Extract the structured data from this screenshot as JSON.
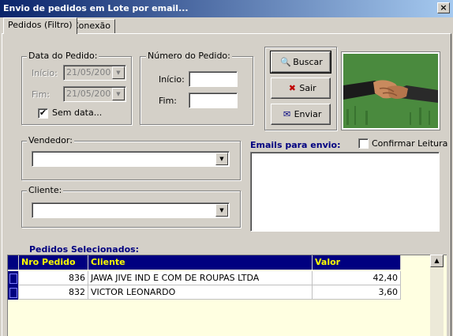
{
  "window": {
    "title": "Envio de pedidos em Lote por email...",
    "close": "×"
  },
  "tabs": [
    {
      "label": "Pedidos (Filtro)",
      "active": true
    },
    {
      "label": "Conexão",
      "active": false
    }
  ],
  "data_pedido": {
    "label": "Data do Pedido:",
    "inicio_label": "Início:",
    "inicio_value": "21/05/200",
    "fim_label": "Fim:",
    "fim_value": "21/05/200",
    "sem_data_label": "Sem data...",
    "sem_data_checked": "✔"
  },
  "numero_pedido": {
    "label": "Número do Pedido:",
    "inicio_label": "Início:",
    "inicio_value": "",
    "fim_label": "Fim:",
    "fim_value": ""
  },
  "buttons": {
    "buscar": {
      "label": "Buscar",
      "icon": "magnifier-icon",
      "glyph": "🔍"
    },
    "sair": {
      "label": "Sair",
      "icon": "red-x-icon",
      "glyph": "✖"
    },
    "enviar": {
      "label": "Enviar",
      "icon": "envelope-icon",
      "glyph": "✉"
    }
  },
  "vendedor": {
    "label": "Vendedor:",
    "value": ""
  },
  "cliente": {
    "label": "Cliente:",
    "value": ""
  },
  "emails": {
    "label": "Emails para envio:",
    "confirmar_label": "Confirmar Leitura",
    "value": ""
  },
  "pedidos": {
    "title": "Pedidos Selecionados:",
    "columns": [
      "Nro Pedido",
      "Cliente",
      "Valor"
    ],
    "rows": [
      {
        "nro": "836",
        "cliente": "JAWA JIVE IND E COM DE ROUPAS LTDA",
        "valor": "42,40"
      },
      {
        "nro": "832",
        "cliente": "VICTOR LEONARDO",
        "valor": "3,60"
      }
    ]
  },
  "colors": {
    "titlebar_start": "#0a246a",
    "grid_header_bg": "#000080",
    "grid_header_fg": "#ffff00",
    "grid_bg": "#ffffe1",
    "section_title": "#000080"
  }
}
